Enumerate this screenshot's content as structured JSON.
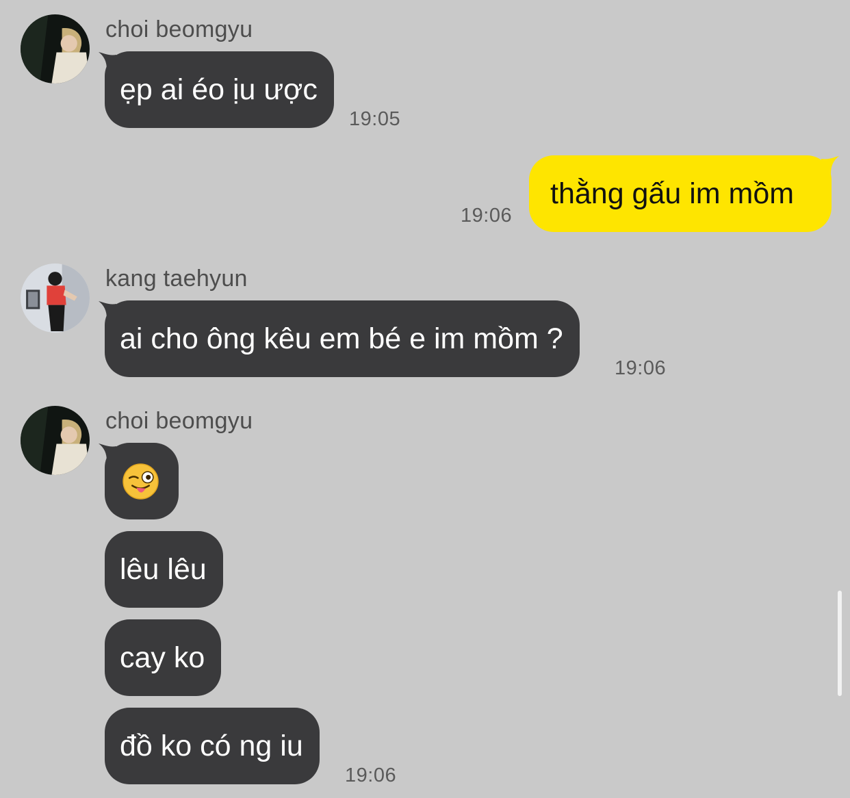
{
  "messages": [
    {
      "sender": "choi beomgyu",
      "text": "ẹp ai éo ịu ược",
      "time": "19:05"
    },
    {
      "text": "thằng gấu im mồm",
      "time": "19:06"
    },
    {
      "sender": "kang taehyun",
      "text": "ai cho ông kêu em bé e im mồm ?",
      "time": "19:06"
    },
    {
      "sender": "choi beomgyu",
      "emoji": "winking-face-with-tongue",
      "lines": [
        "lêu lêu",
        "cay ko",
        "đồ ko có ng iu"
      ],
      "time": "19:06"
    }
  ],
  "colors": {
    "background": "#c9c9c9",
    "incoming_bubble": "#3a3a3c",
    "outgoing_bubble": "#fee500"
  }
}
